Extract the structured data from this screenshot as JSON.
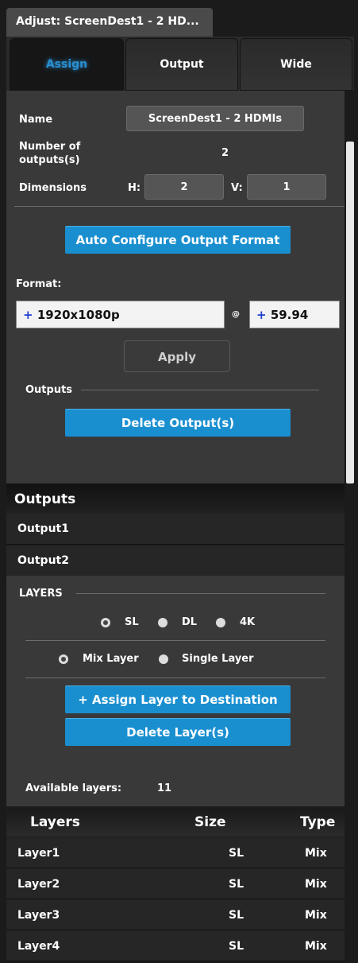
{
  "window": {
    "title": "Adjust: ScreenDest1 - 2 HD..."
  },
  "tabs": [
    {
      "label": "Assign"
    },
    {
      "label": "Output"
    },
    {
      "label": "Wide"
    }
  ],
  "config": {
    "name_label": "Name",
    "name_value": "ScreenDest1 - 2 HDMIs",
    "outputs_count_label_line1": "Number of",
    "outputs_count_label_line2": "outputs(s)",
    "outputs_count_value": "2",
    "dimensions_label": "Dimensions",
    "h_label": "H:",
    "h_value": "2",
    "v_label": "V:",
    "v_value": "1",
    "auto_configure_label": "Auto Configure Output Format",
    "format_label": "Format:",
    "format_prefix": "+",
    "format_value": "1920x1080p",
    "at_symbol": "@",
    "rate_prefix": "+",
    "rate_value": "59.94",
    "apply_label": "Apply",
    "outputs_sub_label": "Outputs",
    "delete_outputs_label": "Delete Output(s)"
  },
  "outputs_section": {
    "title": "Outputs",
    "items": [
      "Output1",
      "Output2"
    ]
  },
  "layers_panel": {
    "title": "LAYERS",
    "resolution_options": [
      {
        "label": "SL",
        "selected": true
      },
      {
        "label": "DL",
        "selected": false
      },
      {
        "label": "4K",
        "selected": false
      }
    ],
    "layer_type_options": [
      {
        "label": "Mix Layer",
        "selected": true
      },
      {
        "label": "Single Layer",
        "selected": false
      }
    ],
    "assign_label": "+ Assign Layer to Destination",
    "delete_label": "Delete Layer(s)",
    "available_label": "Available layers:",
    "available_value": "11"
  },
  "layers_table": {
    "columns": [
      "Layers",
      "Size",
      "Type"
    ],
    "rows": [
      {
        "name": "Layer1",
        "size": "SL",
        "type": "Mix"
      },
      {
        "name": "Layer2",
        "size": "SL",
        "type": "Mix"
      },
      {
        "name": "Layer3",
        "size": "SL",
        "type": "Mix"
      },
      {
        "name": "Layer4",
        "size": "SL",
        "type": "Mix"
      }
    ]
  },
  "colors": {
    "accent": "#1a8fd0",
    "panel": "#393939",
    "background": "#1b1b1b"
  }
}
